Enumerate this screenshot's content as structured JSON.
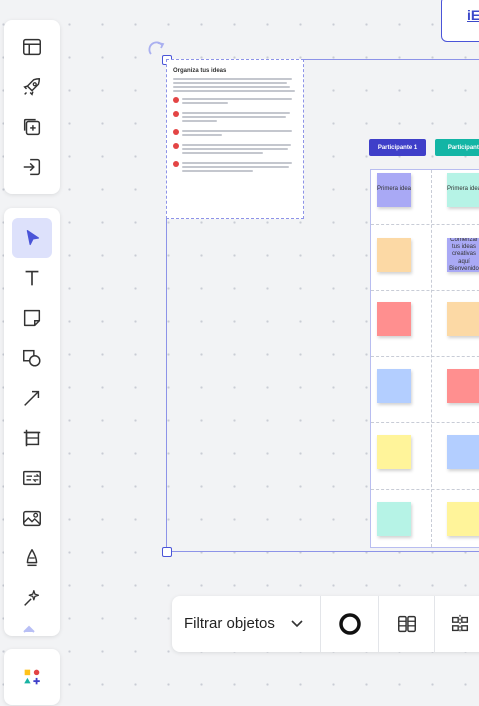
{
  "top_button": {
    "label": "iE"
  },
  "toolbar": {
    "group1": [
      {
        "name": "layout-icon"
      },
      {
        "name": "rocket-icon"
      },
      {
        "name": "add-frame-icon"
      },
      {
        "name": "import-icon"
      }
    ],
    "group2": [
      {
        "name": "select-cursor-icon",
        "active": true
      },
      {
        "name": "text-icon"
      },
      {
        "name": "sticky-note-icon"
      },
      {
        "name": "shapes-icon"
      },
      {
        "name": "arrow-icon"
      },
      {
        "name": "frame-icon"
      },
      {
        "name": "card-icon"
      },
      {
        "name": "image-icon"
      },
      {
        "name": "pen-icon"
      },
      {
        "name": "magic-icon"
      }
    ],
    "group3": [
      {
        "name": "more-shapes-icon"
      }
    ]
  },
  "canvas": {
    "doc_card": {
      "title": "Organiza tus ideas"
    },
    "headers": [
      {
        "label": "Participante 1",
        "color": "#3f3fc9"
      },
      {
        "label": "Participante",
        "color": "#13b5a5"
      }
    ],
    "stickies": [
      {
        "col": 0,
        "row": 0,
        "color": "#a9a9f5",
        "text": "Primera idea"
      },
      {
        "col": 1,
        "row": 0,
        "color": "#b6f3e6",
        "text": "Primera idea"
      },
      {
        "col": 0,
        "row": 1,
        "color": "#fcd9a5",
        "text": ""
      },
      {
        "col": 1,
        "row": 1,
        "color": "#a9a9f5",
        "text": "Comenzar tus ideas creativas aquí Bienvenido"
      },
      {
        "col": 0,
        "row": 2,
        "color": "#ff8f8f",
        "text": ""
      },
      {
        "col": 1,
        "row": 2,
        "color": "#fcd9a5",
        "text": ""
      },
      {
        "col": 0,
        "row": 3,
        "color": "#b3ceff",
        "text": ""
      },
      {
        "col": 1,
        "row": 3,
        "color": "#ff8f8f",
        "text": ""
      },
      {
        "col": 0,
        "row": 4,
        "color": "#fff49a",
        "text": ""
      },
      {
        "col": 1,
        "row": 4,
        "color": "#b3ceff",
        "text": ""
      },
      {
        "col": 0,
        "row": 5,
        "color": "#b6f3e6",
        "text": ""
      },
      {
        "col": 1,
        "row": 5,
        "color": "#fff49a",
        "text": ""
      }
    ]
  },
  "bottom_bar": {
    "filter_label": "Filtrar objetos"
  }
}
